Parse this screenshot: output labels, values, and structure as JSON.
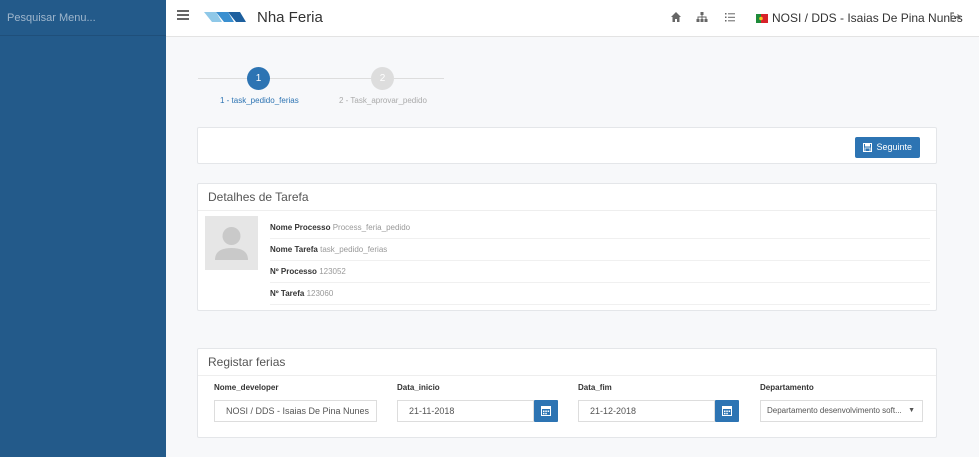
{
  "sidebar": {
    "search_placeholder": "Pesquisar Menu..."
  },
  "header": {
    "app_title": "Nha Feria",
    "user_label": "NOSI / DDS - Isaias De Pina Nunes"
  },
  "stepper": {
    "steps": [
      {
        "number": "1",
        "label": "1 - task_pedido_ferias"
      },
      {
        "number": "2",
        "label": "2 - Task_aprovar_pedido"
      }
    ]
  },
  "toolbar": {
    "next_label": "Seguinte"
  },
  "task_details": {
    "title": "Detalhes de Tarefa",
    "rows": [
      {
        "label": "Nome Processo",
        "value": "Process_feria_pedido"
      },
      {
        "label": "Nome Tarefa",
        "value": "task_pedido_ferias"
      },
      {
        "label": "Nº Processo",
        "value": "123052"
      },
      {
        "label": "Nº Tarefa",
        "value": "123060"
      }
    ]
  },
  "register": {
    "title": "Registar ferias",
    "fields": {
      "developer": {
        "label": "Nome_developer",
        "value": "NOSI / DDS - Isaias De Pina Nunes"
      },
      "start": {
        "label": "Data_inicio",
        "value": "21-11-2018"
      },
      "end": {
        "label": "Data_fim",
        "value": "21-12-2018"
      },
      "department": {
        "label": "Departamento",
        "value": "Departamento desenvolvimento soft..."
      }
    }
  },
  "colors": {
    "primary": "#2d74b3",
    "sidebar": "#235a8a",
    "step_inactive": "#dddddd"
  }
}
